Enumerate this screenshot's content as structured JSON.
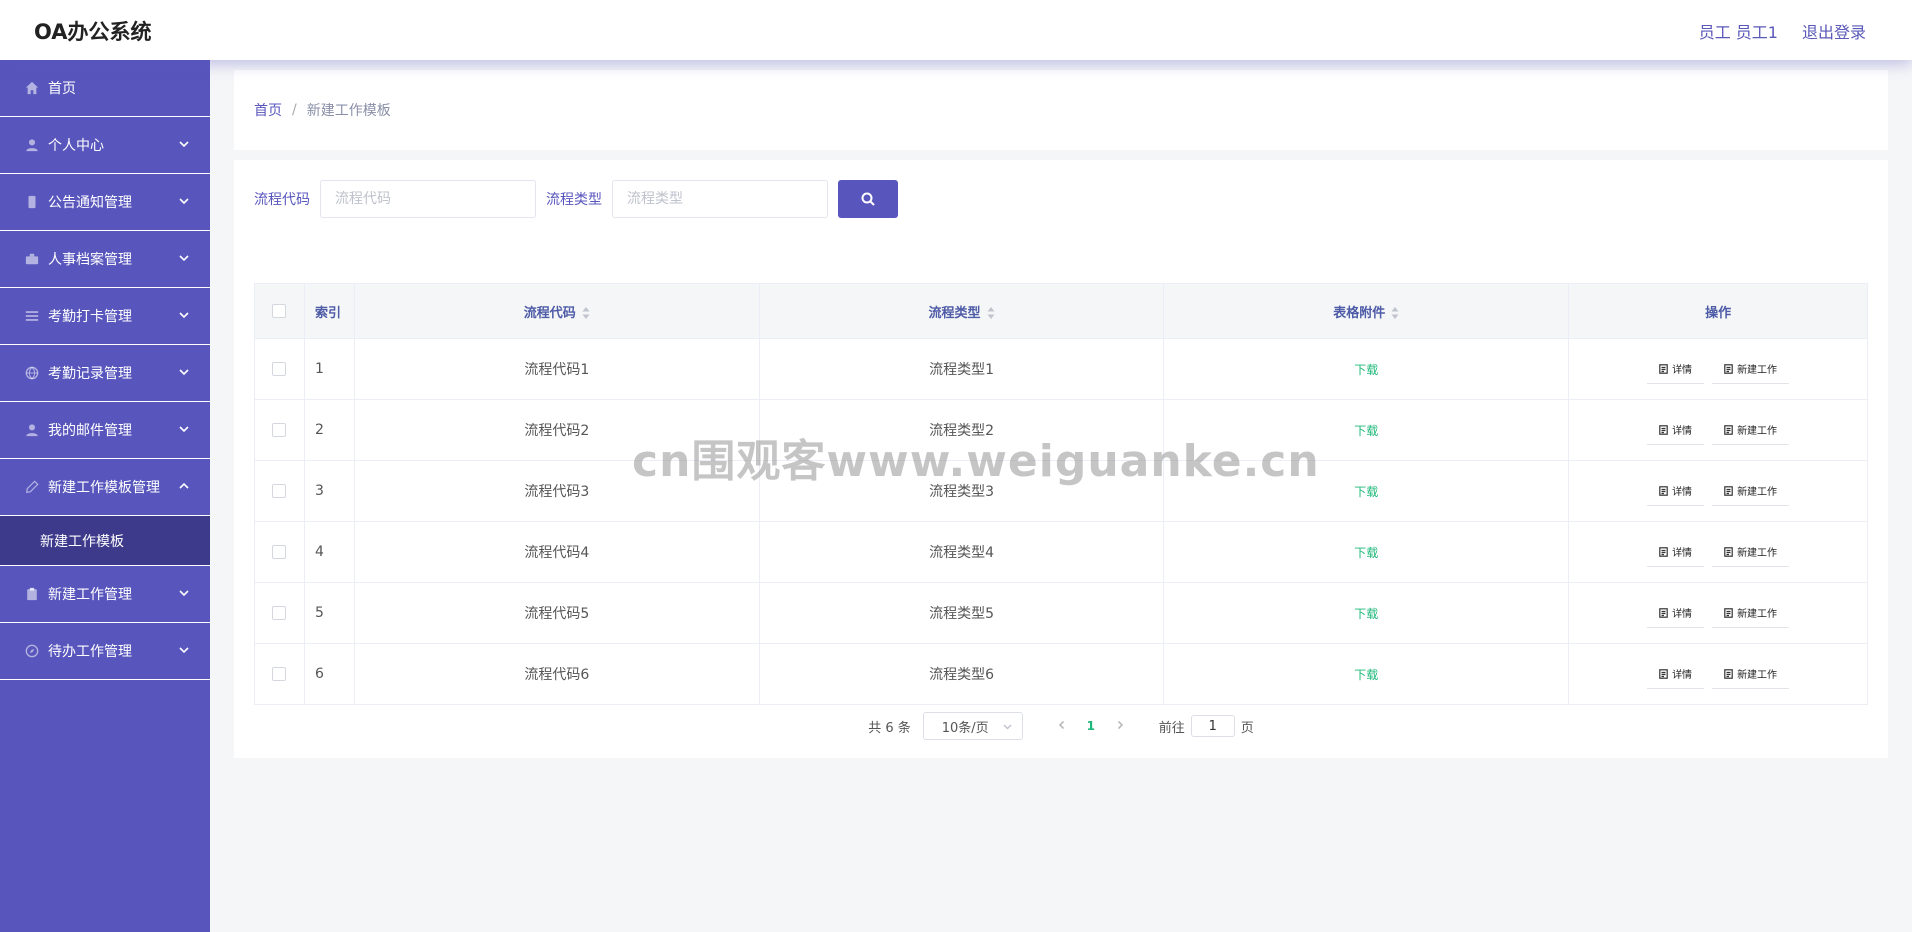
{
  "header": {
    "app_title": "OA办公系统",
    "user_label": "员工 员工1",
    "logout_label": "退出登录"
  },
  "sidebar": {
    "items": [
      {
        "label": "首页",
        "icon": "home-icon",
        "has_children": false
      },
      {
        "label": "个人中心",
        "icon": "user-icon",
        "has_children": true
      },
      {
        "label": "公告通知管理",
        "icon": "mobile-icon",
        "has_children": true
      },
      {
        "label": "人事档案管理",
        "icon": "briefcase-icon",
        "has_children": true
      },
      {
        "label": "考勤打卡管理",
        "icon": "list-icon",
        "has_children": true
      },
      {
        "label": "考勤记录管理",
        "icon": "globe-icon",
        "has_children": true
      },
      {
        "label": "我的邮件管理",
        "icon": "user-icon",
        "has_children": true
      },
      {
        "label": "新建工作模板管理",
        "icon": "edit-icon",
        "has_children": true,
        "expanded": true
      },
      {
        "label": "新建工作管理",
        "icon": "clipboard-icon",
        "has_children": true
      },
      {
        "label": "待办工作管理",
        "icon": "compass-icon",
        "has_children": true
      }
    ],
    "active_submenu": "新建工作模板"
  },
  "breadcrumb": {
    "home": "首页",
    "separator": "/",
    "current": "新建工作模板"
  },
  "search": {
    "code_label": "流程代码",
    "code_placeholder": "流程代码",
    "type_label": "流程类型",
    "type_placeholder": "流程类型"
  },
  "table": {
    "headers": {
      "index": "索引",
      "code": "流程代码",
      "type": "流程类型",
      "file": "表格附件",
      "ops": "操作"
    },
    "download_label": "下载",
    "detail_label": "详情",
    "new_work_label": "新建工作",
    "rows": [
      {
        "index": "1",
        "code": "流程代码1",
        "type": "流程类型1"
      },
      {
        "index": "2",
        "code": "流程代码2",
        "type": "流程类型2"
      },
      {
        "index": "3",
        "code": "流程代码3",
        "type": "流程类型3"
      },
      {
        "index": "4",
        "code": "流程代码4",
        "type": "流程类型4"
      },
      {
        "index": "5",
        "code": "流程代码5",
        "type": "流程类型5"
      },
      {
        "index": "6",
        "code": "流程代码6",
        "type": "流程类型6"
      }
    ]
  },
  "pagination": {
    "total": "共 6 条",
    "page_size": "10条/页",
    "current_page": "1",
    "goto_label": "前往",
    "goto_value": "1",
    "page_unit": "页"
  },
  "watermark": "cn围观客www.weiguanke.cn",
  "colors": {
    "primary": "#5856bd",
    "submenu_active": "#3d3a8c",
    "download": "#1fb87a"
  }
}
